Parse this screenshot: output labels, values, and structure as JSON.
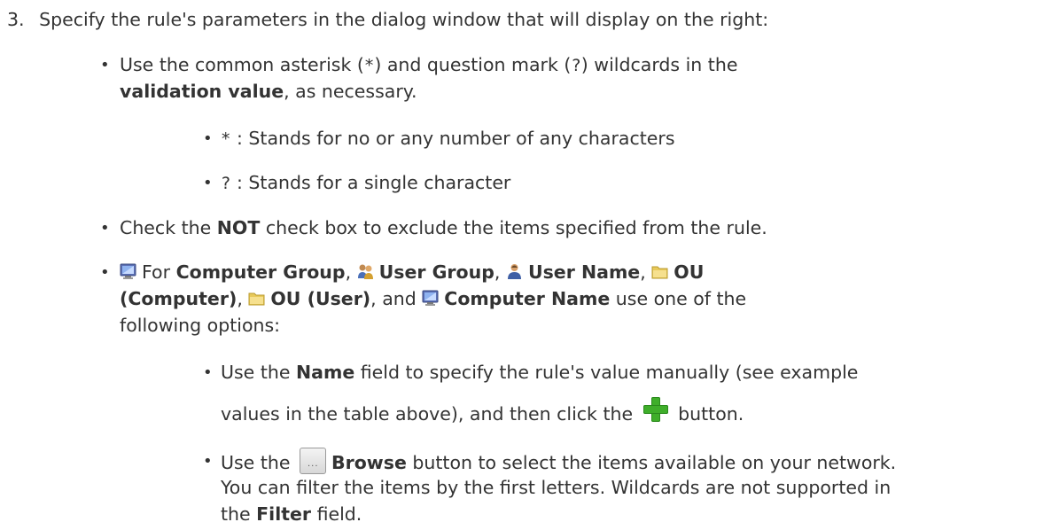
{
  "step": {
    "number": "3.",
    "text": "Specify the rule's parameters in the dialog window that will display on the right:"
  },
  "wildcards": {
    "line1_pre": "Use the common asterisk (",
    "asterisk": "*",
    "line1_mid": ") and question mark (",
    "question": "?",
    "line1_post": ") wildcards in the",
    "bold": "validation value",
    "line2_post": ", as necessary.",
    "sub1_symbol": "*",
    "sub1_text": " : Stands for no or any number of any characters",
    "sub2_symbol": "?",
    "sub2_text": " : Stands for a single character"
  },
  "not_item": {
    "pre": "Check the ",
    "bold": "NOT",
    "post": " check box to exclude the items specified from the rule."
  },
  "groups_item": {
    "for_text": "For ",
    "computer_group": "Computer Group",
    "comma": ", ",
    "user_group": "User Group",
    "user_name": "User Name",
    "ou_computer_1": "OU",
    "ou_computer_2": "(Computer)",
    "ou_user": "OU (User)",
    "and_text": ", and ",
    "computer_name": "Computer Name",
    "post": " use one of the",
    "line3": "following options:"
  },
  "name_option": {
    "pre": "Use the ",
    "bold": "Name",
    "post": " field to specify the rule's value manually (see example",
    "line2_pre": "values in the table above), and then click the ",
    "line2_post": " button."
  },
  "browse_option": {
    "pre": "Use the ",
    "bold": "Browse",
    "post": " button to select the items available on your network.",
    "line2": "You can filter the items by the first letters. Wildcards are not supported in",
    "line3_pre": "the ",
    "line3_bold": "Filter",
    "line3_post": " field."
  },
  "icons": {
    "computer": "computer-monitor-icon",
    "user_group": "user-group-icon",
    "user": "user-icon",
    "folder": "folder-icon",
    "add": "green-plus-icon",
    "browse": "browse-button-icon"
  },
  "colors": {
    "text": "#333333",
    "plus_green": "#3fae2a"
  }
}
